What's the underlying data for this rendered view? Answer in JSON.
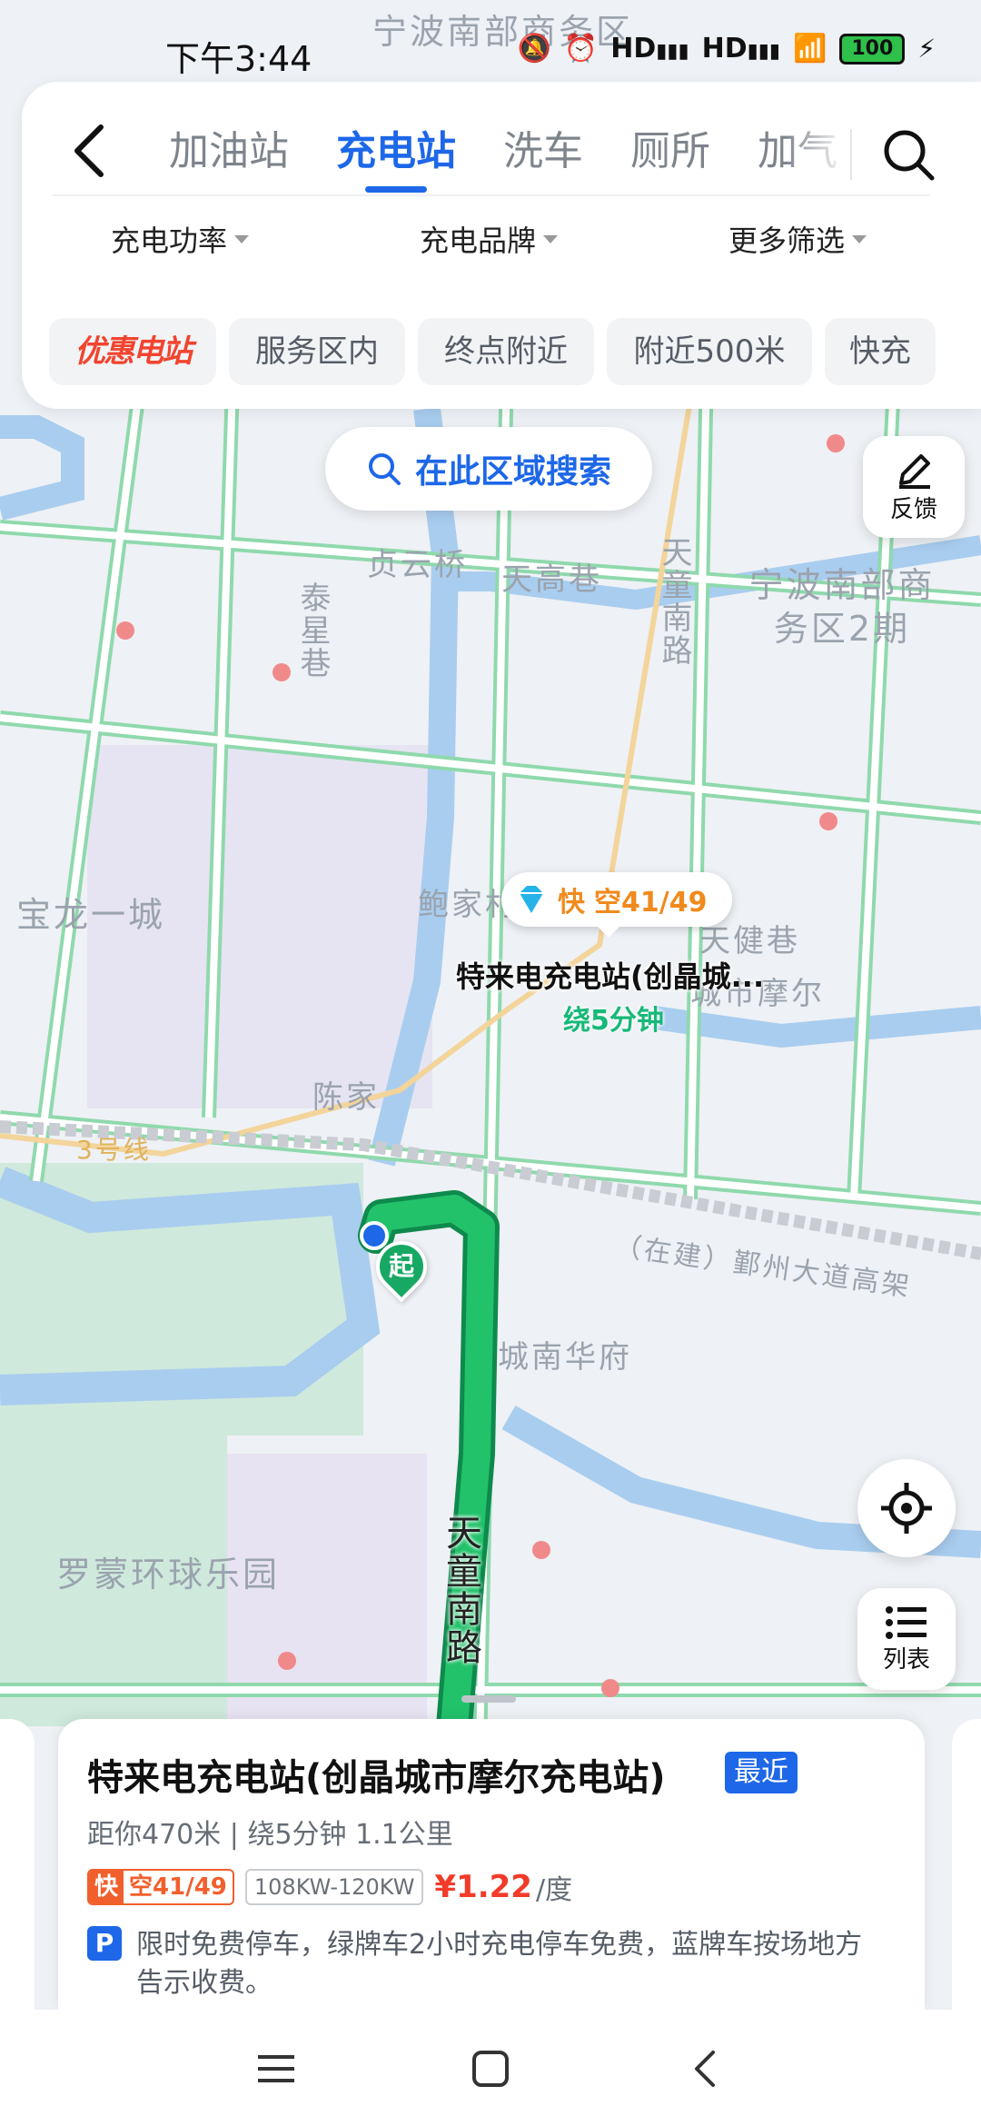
{
  "status_bar": {
    "time": "下午3:44",
    "icons": [
      "mute-icon",
      "alarm-icon",
      "hd-signal-icon",
      "hd-signal-icon",
      "wifi-icon",
      "charging-icon"
    ],
    "hd1": "HD",
    "hd2": "HD",
    "battery": "100"
  },
  "header": {
    "tabs": [
      "加油站",
      "充电站",
      "洗车",
      "厕所",
      "加气"
    ],
    "active_tab": "充电站",
    "filters": [
      "充电功率",
      "充电品牌",
      "更多筛选"
    ],
    "chips": [
      "优惠电站",
      "服务区内",
      "终点附近",
      "附近500米",
      "快充"
    ]
  },
  "map": {
    "search_area_label": "在此区域搜索",
    "feedback_label": "反馈",
    "list_label": "列表",
    "labels": {
      "business_district": "宁波南部商务区",
      "business_district_2": "宁波南部商务区2期",
      "baolong": "宝龙一城",
      "baojia": "鲍家村",
      "chenjia": "陈家",
      "qinxing": "泰星巷",
      "tianggao": "天高巷",
      "yunqiao": "贞云桥",
      "tiantong_top": "天童南路",
      "tiantong_bottom": "天童南路",
      "jianxiang": "天健巷",
      "chengnan": "城南华府",
      "luomeng": "罗蒙环球乐园",
      "metro": "3号线",
      "expressway": "（在建）鄞州大道高架",
      "mall": "城市摩尔"
    },
    "start_label": "起",
    "marker": {
      "fast": "快",
      "availability": "空41/49",
      "name": "特来电充电站(创晶城...",
      "detour": "绕5分钟"
    }
  },
  "card": {
    "title": "特来电充电站(创晶城市摩尔充电站)",
    "badge": "最近",
    "distance": "距你470米 | 绕5分钟 1.1公里",
    "fast_tag": "快",
    "availability": "空41/49",
    "power": "108KW-120KW",
    "price": "¥1.22",
    "price_unit": "/度",
    "parking_icon": "P",
    "parking_text": "限时免费停车，绿牌车2小时充电停车免费，蓝牌车按场地方告示收费。"
  },
  "colors": {
    "accent": "#1d67e8",
    "route": "#17a864",
    "price": "#f23b2a",
    "fast": "#f08a1d"
  }
}
